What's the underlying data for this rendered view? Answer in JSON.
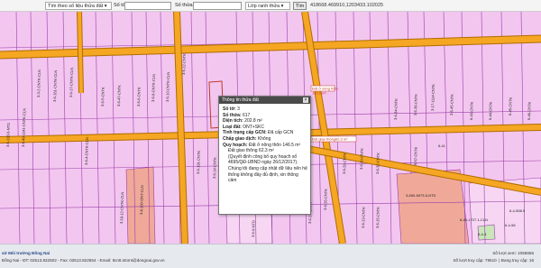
{
  "toolbar": {
    "search_mode": "Tìm theo số liệu thửa đất",
    "sheet_label": "Số tờ",
    "sheet_value": "",
    "parcel_label": "Số thửa",
    "parcel_value": "",
    "layer_select": "Lớp ranh thửa",
    "search_button": "Tìm",
    "coordinates": "418668.469910,1203433.102025"
  },
  "map": {
    "parcel_labels": [
      "3-6-130-5-NTD",
      "3-6-49-1141-CNTK-CLN",
      "3-3-2-CNTK-CLN",
      "3-6-161-CNTK-CLN",
      "3-6-17-CNTK-CLN",
      "3-6-4-CNTK-CLN",
      "3-6-5-CNTK",
      "3-6-47-CNTK",
      "3-6-6-CNTK",
      "3-6-8-CNTK-CLN",
      "3-6-10-CNTK-CLN",
      "3-6-12-CNTK",
      "3-6-181-CNTK",
      "3-6-14-CNTK",
      "3-6-16-CNTK",
      "3-6-18-CNTK",
      "3-6-20-CNTK",
      "3-6-22-CNTK-CLN",
      "3-6-24-CNTK",
      "3-6-26-CNTK",
      "3-6-28-CNTK",
      "3-6-30-CNTK",
      "3-6-32-CNTK",
      "3-6-34-CNTK",
      "3-6-36-CNTK",
      "3-17-1114-CNTK",
      "3-6-45-CNTK",
      "3-8-100-ONT-CLN",
      "3-18-12-CNTK-CLN",
      "3-6-9-NTD",
      "3-6-13-CNTK",
      "3-6-15-CNTK",
      "3-650-6973.5-NTD",
      "6-44-1727.1-CLN",
      "6-4-558.9",
      "6-43-CNTK",
      "6-44-CNTK",
      "6-45-CNTK",
      "6-46-CNTK",
      "6-57-CNTK",
      "6-41",
      "6-4-3",
      "6-4-56"
    ],
    "zone_labels": [
      "Đất ở nông thôn",
      "Đất giao thông"
    ],
    "zone_values": [
      "146.5 m²",
      "62.3 m²"
    ],
    "colors": {
      "parcel_fill": "#f3c6f0",
      "parcel_line": "#9a3fa8",
      "road": "#f5a623",
      "road_edge": "#b06d00",
      "highlight": "#c0392b",
      "salmon": "#f0a999",
      "green": "#c8e6b8"
    }
  },
  "popup": {
    "title": "Thông tin thửa đất",
    "close": "×",
    "rows": [
      {
        "label": "Số tờ:",
        "value": "3"
      },
      {
        "label": "Số thửa:",
        "value": "617"
      },
      {
        "label": "Diện tích:",
        "value": "202.8 m²"
      },
      {
        "label": "Loại đất:",
        "value": "ONT+SKC"
      },
      {
        "label": "Tình trạng cấp GCN:",
        "value": "Đã cấp GCN"
      },
      {
        "label": "Chấp giao dịch:",
        "value": "Không"
      },
      {
        "label": "Quy hoạch:",
        "value": "Đất ở nông thôn 146.5 m²"
      }
    ],
    "plan_extra": "Đất giao thông 62.3 m²",
    "plan_note": "(Quyết định công bố quy hoạch số 4695/QĐ-UBND ngày 26/12/2017). Chúng tôi đang cập nhật dữ liệu nên hệ thống không đầy đủ định, xin thông cảm"
  },
  "footer": {
    "org": "sở Môi trường Đồng Nai",
    "address": "Đồng Nai - ĐT: 02513.822502 - Fax: 02513.822554 - Email: ttcntt.stnmt@dongnai.gov.vn",
    "visits_label": "Số lượt xem: 1056656",
    "online_label": "Số lượt truy cập: 79510",
    "zoom_label": "Đang truy cập: 16"
  }
}
